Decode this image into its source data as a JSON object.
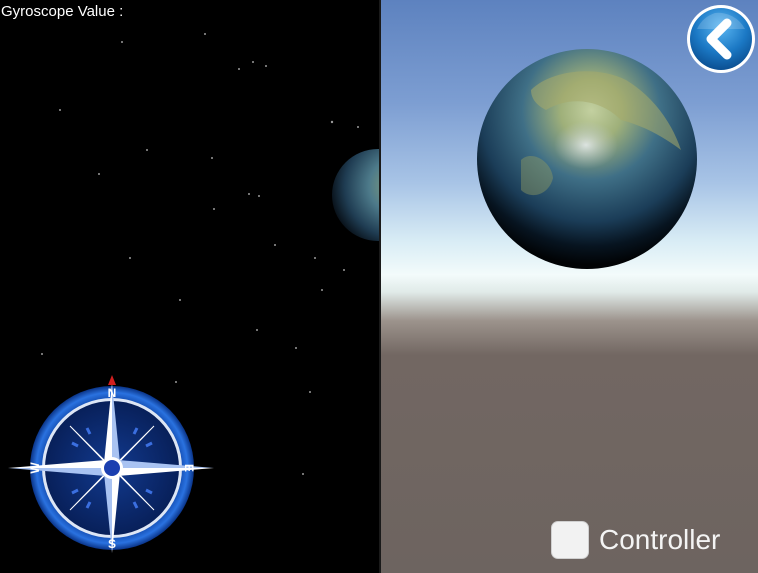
{
  "hud": {
    "gyro_label": "Gyroscope Value :"
  },
  "controls": {
    "controller_label": "Controller",
    "controller_checked": false
  },
  "compass": {
    "north": "N",
    "south": "S",
    "east": "E",
    "west": "W"
  },
  "colors": {
    "compass_ring": "#1e5ec8",
    "compass_needle_north": "#d21f1f",
    "back_button": "#1b78c4",
    "space_background": "#000000",
    "ground": "#6d6460"
  },
  "icons": {
    "back": "chevron-left-icon",
    "compass": "compass-rose-icon"
  }
}
